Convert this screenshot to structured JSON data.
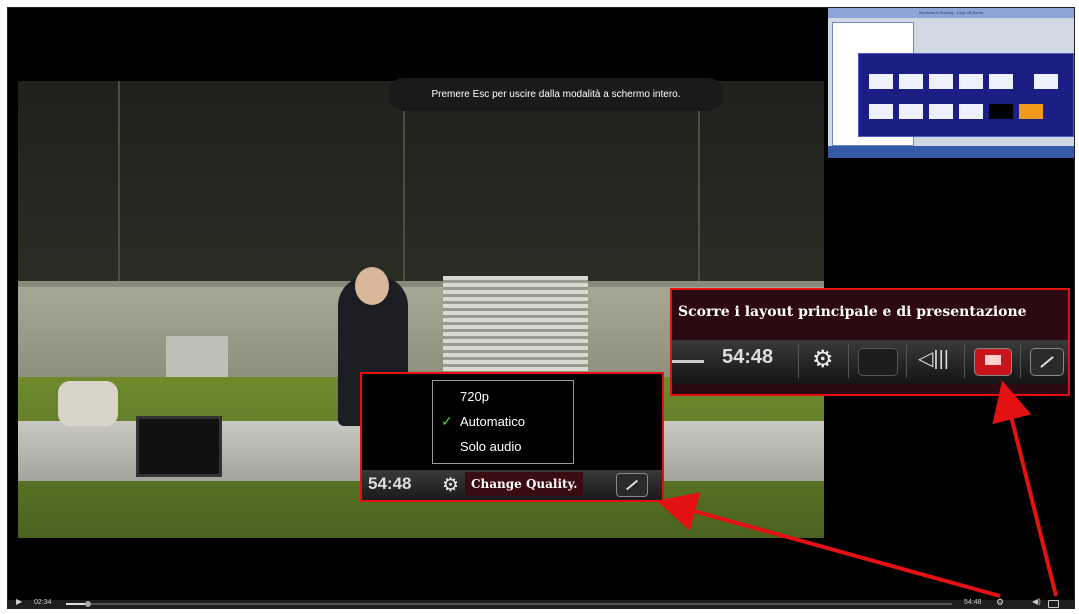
{
  "fullscreen_toast": "Premere Esc per uscire dalla modalità a schermo intero.",
  "quality_menu": {
    "options": [
      "720p",
      "Automatico",
      "Solo audio"
    ],
    "selected": "Automatico"
  },
  "quality_inset": {
    "time": "54:48",
    "tooltip": "Change Quality."
  },
  "layout_inset": {
    "title": "Scorre i layout principale e di presentazione",
    "time": "54:48"
  },
  "player": {
    "current_time": "02:34",
    "duration": "54:48",
    "progress_fraction": 0.04
  },
  "presentation": {
    "window_title": "Windows 8 Sharing - Logo 28 Demo"
  },
  "colors": {
    "highlight": "#e31111",
    "tooltip_bg": "#3b0b12",
    "check": "#4ccf3f"
  },
  "icons": [
    "play-icon",
    "gear-icon",
    "volume-icon",
    "layout-switch-icon",
    "fullscreen-icon",
    "checkmark-icon"
  ]
}
